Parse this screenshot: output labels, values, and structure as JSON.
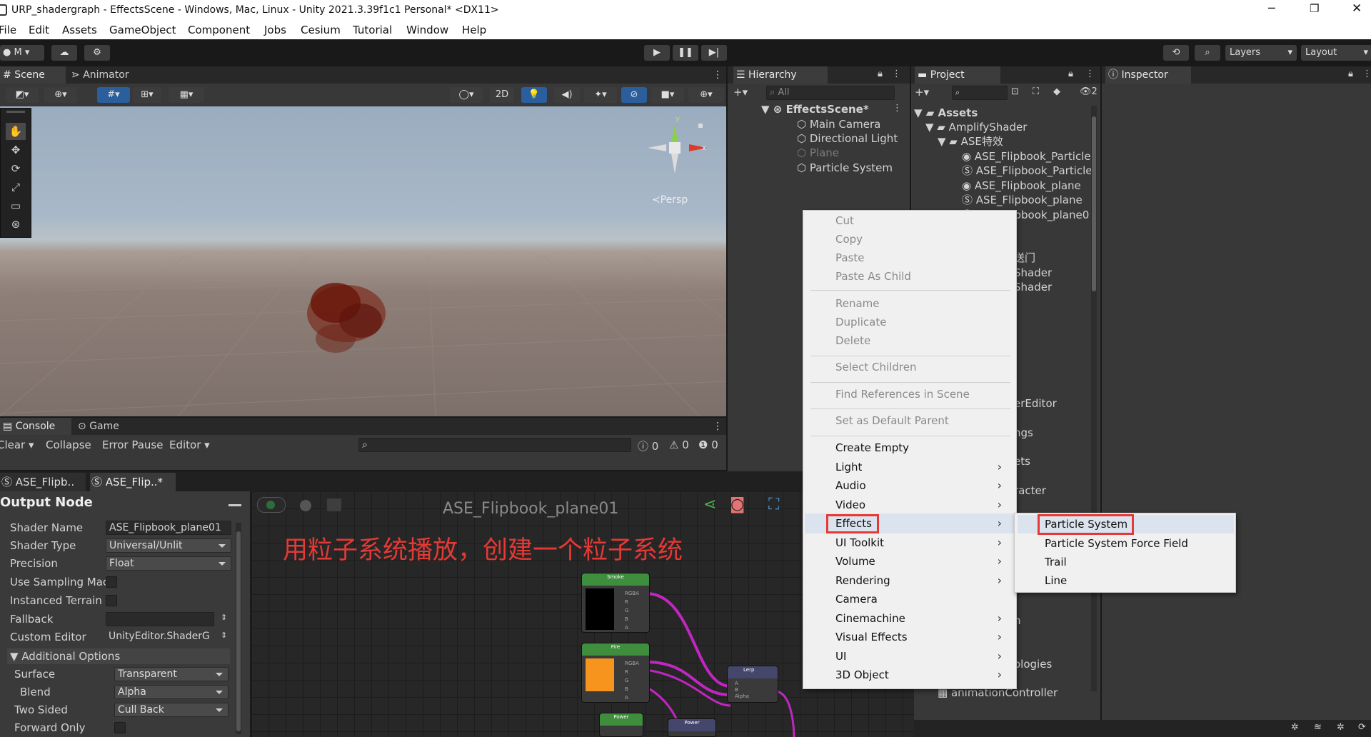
{
  "window": {
    "title": "URP_shadergraph - EffectsScene - Windows, Mac, Linux - Unity 2021.3.39f1c1 Personal* <DX11>"
  },
  "menu": [
    "File",
    "Edit",
    "Assets",
    "GameObject",
    "Component",
    "Jobs",
    "Cesium",
    "Tutorial",
    "Window",
    "Help"
  ],
  "toolbar": {
    "account": "M",
    "layers": "Layers",
    "layout": "Layout"
  },
  "scene_tabs": {
    "scene": "Scene",
    "animator": "Animator"
  },
  "scene_toolbar": {
    "mode_2d": "2D"
  },
  "gizmo": {
    "y": "y",
    "x": "x",
    "persp": "Persp"
  },
  "console": {
    "tabs": {
      "console": "Console",
      "game": "Game"
    },
    "clear": "Clear",
    "collapse": "Collapse",
    "error_pause": "Error Pause",
    "editor": "Editor",
    "info_count": "0",
    "warn_count": "0",
    "error_count": "0"
  },
  "hierarchy": {
    "tab": "Hierarchy",
    "search_placeholder": "All",
    "scene": "EffectsScene*",
    "items": [
      "Main Camera",
      "Directional Light",
      "Plane",
      "Particle System"
    ]
  },
  "project": {
    "tab": "Project",
    "badge": "2",
    "root": "Assets",
    "items": [
      "AmplifyShader",
      "ASE特效",
      "ASE_Flipbook_Particle",
      "ASE_Flipbook_Particle",
      "ASE_Flipbook_plane",
      "ASE_Flipbook_plane",
      "ASE_Flipbook_plane0"
    ],
    "partial": [
      "送门",
      "Shader",
      "Shader",
      "erEditor",
      "ngs",
      "ets",
      "racter",
      "n",
      "ologies"
    ],
    "bottom": "animationController"
  },
  "inspector": {
    "tab": "Inspector"
  },
  "shader_tabs": [
    "ASE_Flipb..",
    "ASE_Flip..*"
  ],
  "output_node": {
    "title": "Output Node",
    "props": [
      {
        "label": "Shader Name",
        "value": "ASE_Flipbook_plane01"
      },
      {
        "label": "Shader Type",
        "value": "Universal/Unlit"
      },
      {
        "label": "Precision",
        "value": "Float"
      },
      {
        "label": "Use Sampling Mac",
        "value": ""
      },
      {
        "label": "Instanced Terrain",
        "value": ""
      },
      {
        "label": "Fallback",
        "value": ""
      },
      {
        "label": "Custom Editor",
        "value": "UnityEditor.ShaderG"
      }
    ],
    "additional": "Additional Options",
    "surface": {
      "label": "Surface",
      "value": "Transparent"
    },
    "blend": {
      "label": "Blend",
      "value": "Alpha"
    },
    "two_sided": {
      "label": "Two Sided",
      "value": "Cull Back"
    },
    "forward_only": {
      "label": "Forward Only"
    }
  },
  "graph": {
    "title": "ASE_Flipbook_plane01",
    "annotation": "用粒子系统播放，创建一个粒子系统",
    "nodes": {
      "smoke": "Smoke",
      "fire": "Fire",
      "lerp": "Lerp",
      "power1": "Power",
      "power2": "Power"
    }
  },
  "context_menu": {
    "items": [
      "Cut",
      "Copy",
      "Paste",
      "Paste As Child",
      "Rename",
      "Duplicate",
      "Delete",
      "Select Children",
      "Find References in Scene",
      "Set as Default Parent",
      "Create Empty",
      "Light",
      "Audio",
      "Video",
      "Effects",
      "UI Toolkit",
      "Volume",
      "Rendering",
      "Camera",
      "Cinemachine",
      "Visual Effects",
      "UI",
      "3D Object"
    ]
  },
  "submenu": {
    "items": [
      "Particle System",
      "Particle System Force Field",
      "Trail",
      "Line"
    ]
  }
}
